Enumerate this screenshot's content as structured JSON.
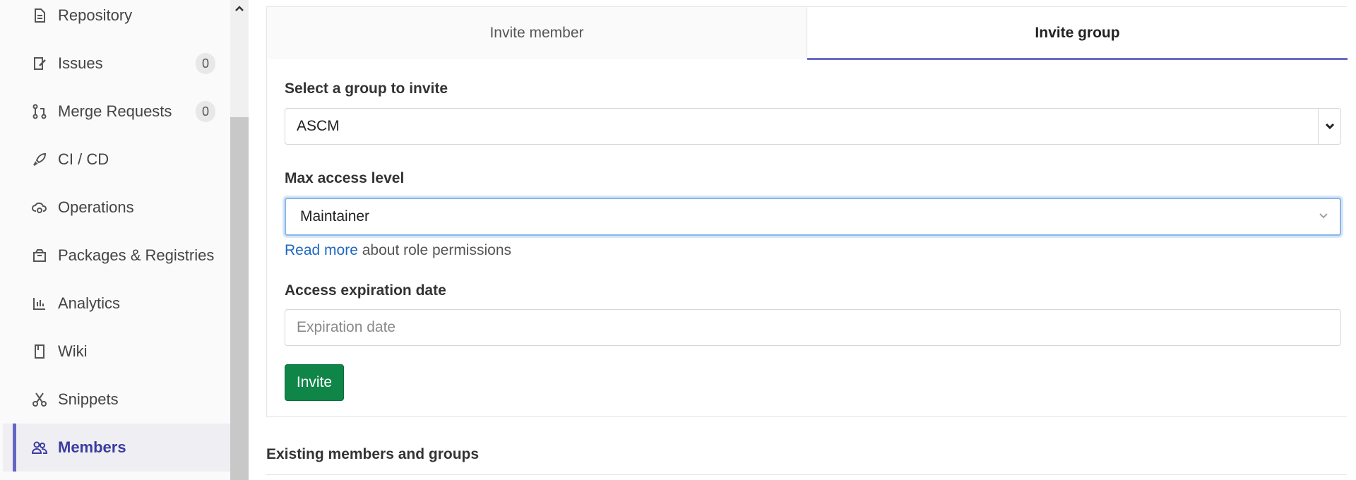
{
  "sidebar": {
    "items": [
      {
        "label": "Repository",
        "icon": "document-icon"
      },
      {
        "label": "Issues",
        "icon": "issues-icon",
        "count": "0"
      },
      {
        "label": "Merge Requests",
        "icon": "merge-request-icon",
        "count": "0"
      },
      {
        "label": "CI / CD",
        "icon": "rocket-icon"
      },
      {
        "label": "Operations",
        "icon": "cloud-gear-icon"
      },
      {
        "label": "Packages & Registries",
        "icon": "package-icon"
      },
      {
        "label": "Analytics",
        "icon": "bar-chart-icon"
      },
      {
        "label": "Wiki",
        "icon": "book-icon"
      },
      {
        "label": "Snippets",
        "icon": "scissors-icon"
      },
      {
        "label": "Members",
        "icon": "users-icon",
        "active": true
      }
    ]
  },
  "tabs": [
    {
      "label": "Invite member",
      "active": false
    },
    {
      "label": "Invite group",
      "active": true
    }
  ],
  "form": {
    "group_label": "Select a group to invite",
    "group_value": "ASCM",
    "access_label": "Max access level",
    "access_value": "Maintainer",
    "help_link": "Read more",
    "help_text": " about role permissions",
    "expiration_label": "Access expiration date",
    "expiration_placeholder": "Expiration date",
    "invite_button": "Invite"
  },
  "existing_title": "Existing members and groups",
  "colors": {
    "accent": "#6b6bc9",
    "active_nav_text": "#3b3ba0",
    "link": "#1f68c1",
    "invite_button": "#108548",
    "focus_border": "#88b7e8"
  }
}
